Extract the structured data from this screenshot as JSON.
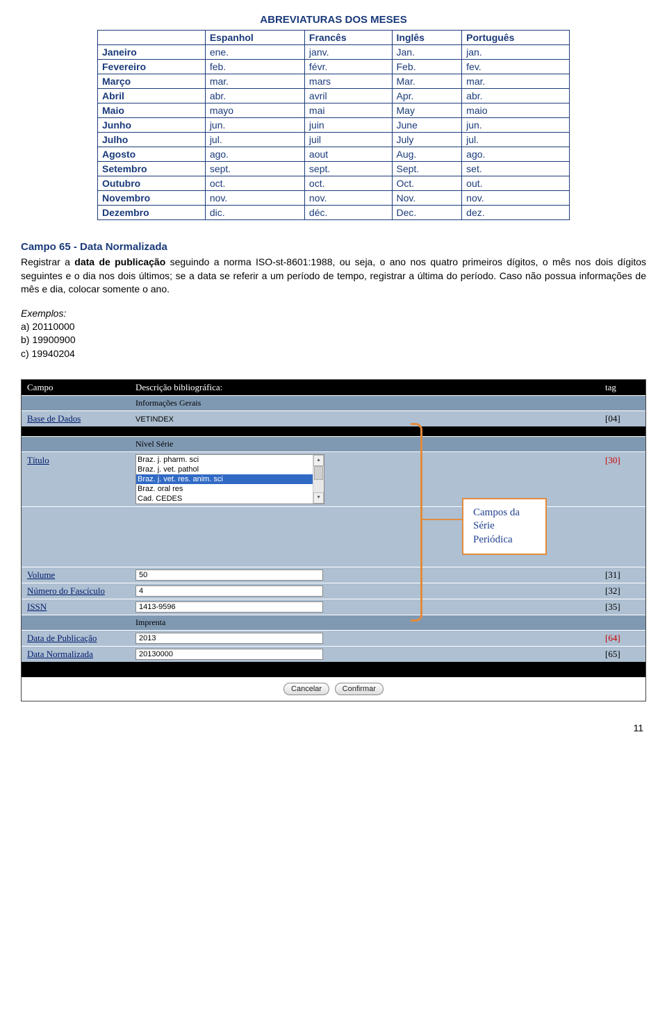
{
  "title": "ABREVIATURAS DOS MESES",
  "table": {
    "headers": [
      "",
      "Espanhol",
      "Francês",
      "Inglês",
      "Português"
    ],
    "rows": [
      [
        "Janeiro",
        "ene.",
        "janv.",
        "Jan.",
        "jan."
      ],
      [
        "Fevereiro",
        "feb.",
        "févr.",
        "Feb.",
        "fev."
      ],
      [
        "Março",
        "mar.",
        "mars",
        "Mar.",
        "mar."
      ],
      [
        "Abril",
        "abr.",
        "avril",
        "Apr.",
        "abr."
      ],
      [
        "Maio",
        "mayo",
        "mai",
        "May",
        "maio"
      ],
      [
        "Junho",
        "jun.",
        "juin",
        "June",
        "jun."
      ],
      [
        "Julho",
        "jul.",
        "juil",
        "July",
        "jul."
      ],
      [
        "Agosto",
        "ago.",
        "aout",
        "Aug.",
        "ago."
      ],
      [
        "Setembro",
        "sept.",
        "sept.",
        "Sept.",
        "set."
      ],
      [
        "Outubro",
        "oct.",
        "oct.",
        "Oct.",
        "out."
      ],
      [
        "Novembro",
        "nov.",
        "nov.",
        "Nov.",
        "nov."
      ],
      [
        "Dezembro",
        "dic.",
        "déc.",
        "Dec.",
        "dez."
      ]
    ]
  },
  "section_heading": "Campo 65 - Data Normalizada",
  "body_part1": "Registrar a ",
  "body_bold": "data de publicação",
  "body_part2": " seguindo a norma ISO-st-8601:1988, ou seja, o ano nos quatro primeiros dígitos, o mês nos dois dígitos seguintes e o dia nos dois últimos; se a data se referir a um período de tempo, registrar a última do período. Caso não possua informações de mês e dia, colocar somente o ano.",
  "examples_label": "Exemplos:",
  "examples": [
    "a) 20110000",
    "b) 19900900",
    "c) 19940204"
  ],
  "form": {
    "header_campo": "Campo",
    "header_desc": "Descrição bibliográfica:",
    "header_tag": "tag",
    "sub_info": "Informações Gerais",
    "base_label": "Base de Dados",
    "base_value": "VETINDEX",
    "base_tag": "[04]",
    "sub_serie": "Nível Série",
    "titulo_label": "Título",
    "titulo_options": [
      "Braz. j. pharm. sci",
      "Braz. j. vet. pathol",
      "Braz. j. vet. res. anim. sci",
      "Braz. oral res",
      "Cad. CEDES"
    ],
    "titulo_selected_index": 2,
    "titulo_tag": "[30]",
    "volume_label": "Volume",
    "volume_value": "50",
    "volume_tag": "[31]",
    "fasc_label": "Número do Fascículo",
    "fasc_value": "4",
    "fasc_tag": "[32]",
    "issn_label": "ISSN",
    "issn_value": "1413-9596",
    "issn_tag": "[35]",
    "sub_imprenta": "Imprenta",
    "datapub_label": "Data de Publicação",
    "datapub_value": "2013",
    "datapub_tag": "[64]",
    "datanorm_label": "Data Normalizada",
    "datanorm_value": "20130000",
    "datanorm_tag": "[65]",
    "btn_cancel": "Cancelar",
    "btn_confirm": "Confirmar"
  },
  "callout": "Campos da Série Periódica",
  "page_number": "11"
}
